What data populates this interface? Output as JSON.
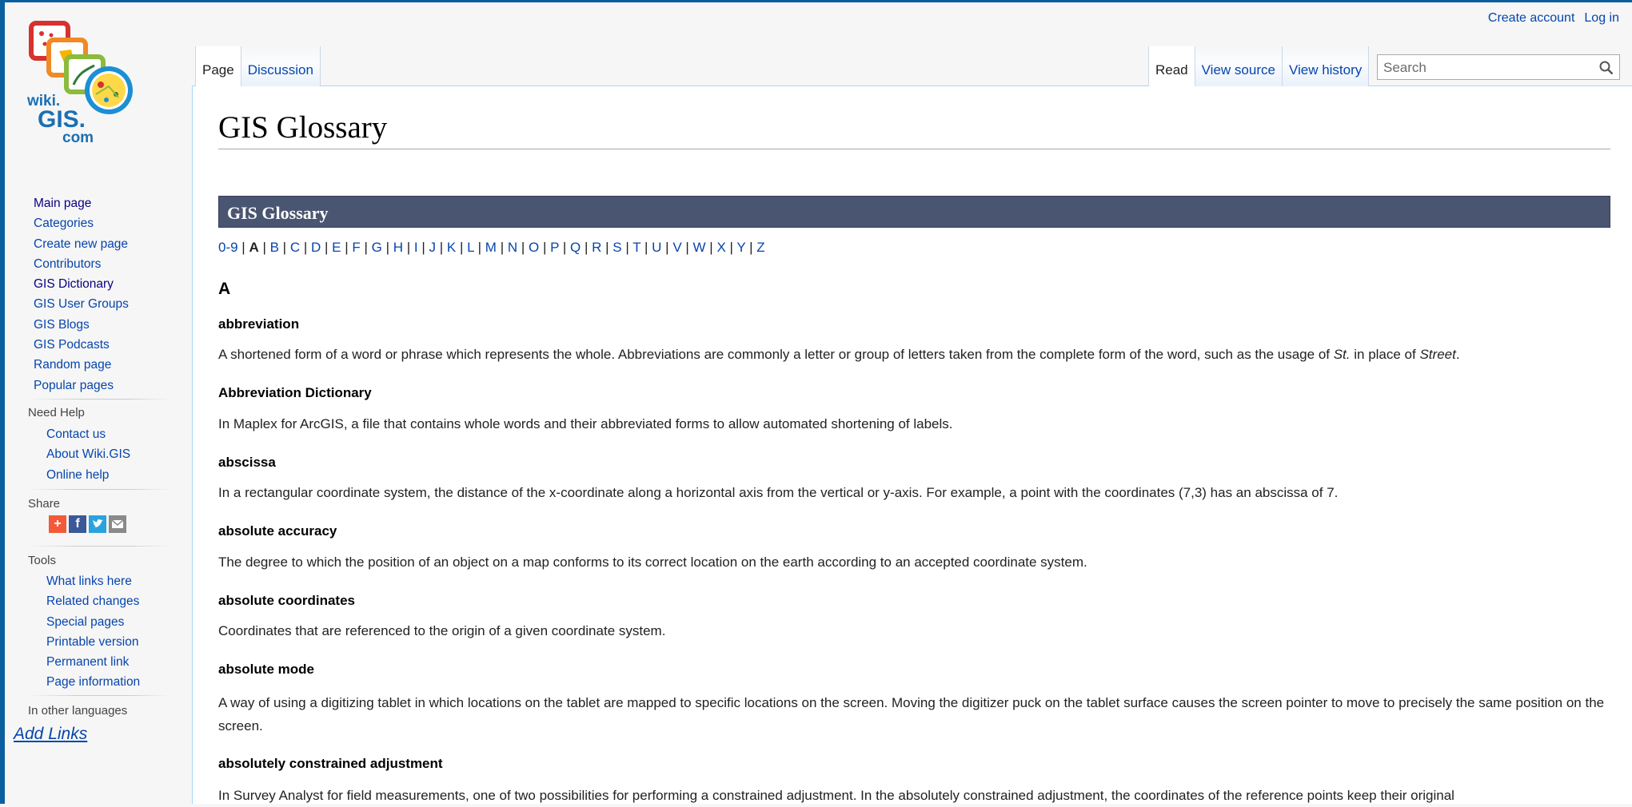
{
  "logo": {
    "line1": "wiki.",
    "line2": "GIS.",
    "line3": "com"
  },
  "personal": {
    "create_account": "Create account",
    "login": "Log in"
  },
  "tabs_left": [
    "Page",
    "Discussion"
  ],
  "tabs_right": [
    "Read",
    "View source",
    "View history"
  ],
  "search": {
    "placeholder": "Search"
  },
  "page": {
    "title": "GIS Glossary",
    "banner": "GIS Glossary",
    "section": "A"
  },
  "alphabet": [
    "0-9",
    "A",
    "B",
    "C",
    "D",
    "E",
    "F",
    "G",
    "H",
    "I",
    "J",
    "K",
    "L",
    "M",
    "N",
    "O",
    "P",
    "Q",
    "R",
    "S",
    "T",
    "U",
    "V",
    "W",
    "X",
    "Y",
    "Z"
  ],
  "alphabet_current": "A",
  "entries": [
    {
      "term": "abbreviation",
      "def_start": "A shortened form of a word or phrase which represents the whole. Abbreviations are commonly a letter or group of letters taken from the complete form of the word, such as the usage of ",
      "def_em1": "St.",
      "def_mid": " in place of ",
      "def_em2": "Street",
      "def_end": "."
    },
    {
      "term": "Abbreviation Dictionary",
      "def": "In Maplex for ArcGIS, a file that contains whole words and their abbreviated forms to allow automated shortening of labels."
    },
    {
      "term": "abscissa",
      "def": "In a rectangular coordinate system, the distance of the x-coordinate along a horizontal axis from the vertical or y-axis. For example, a point with the coordinates (7,3) has an abscissa of 7."
    },
    {
      "term": "absolute accuracy",
      "def": "The degree to which the position of an object on a map conforms to its correct location on the earth according to an accepted coordinate system."
    },
    {
      "term": "absolute coordinates",
      "def": "Coordinates that are referenced to the origin of a given coordinate system."
    },
    {
      "term": "absolute mode",
      "def": "A way of using a digitizing tablet in which locations on the tablet are mapped to specific locations on the screen. Moving the digitizer puck on the tablet surface causes the screen pointer to move to precisely the same position on the screen."
    },
    {
      "term": "absolutely constrained adjustment",
      "def": "In Survey Analyst for field measurements, one of two possibilities for performing a constrained adjustment. In the absolutely constrained adjustment, the coordinates of the reference points keep their original"
    }
  ],
  "sidebar": {
    "main": [
      "Main page",
      "Categories",
      "Create new page",
      "Contributors",
      "GIS Dictionary",
      "GIS User Groups",
      "GIS Blogs",
      "GIS Podcasts",
      "Random page",
      "Popular pages"
    ],
    "help_heading": "Need Help",
    "help": [
      "Contact us",
      "About Wiki.GIS",
      "Online help"
    ],
    "share_heading": "Share",
    "share_icons": [
      "add-this-icon",
      "facebook-icon",
      "twitter-icon",
      "email-icon"
    ],
    "tools_heading": "Tools",
    "tools": [
      "What links here",
      "Related changes",
      "Special pages",
      "Printable version",
      "Permanent link",
      "Page information"
    ],
    "languages_heading": "In other languages",
    "add_links": "Add Links"
  },
  "colors": {
    "frame": "#0b5f9e",
    "link": "#0645ad",
    "banner": "#4a5572"
  }
}
